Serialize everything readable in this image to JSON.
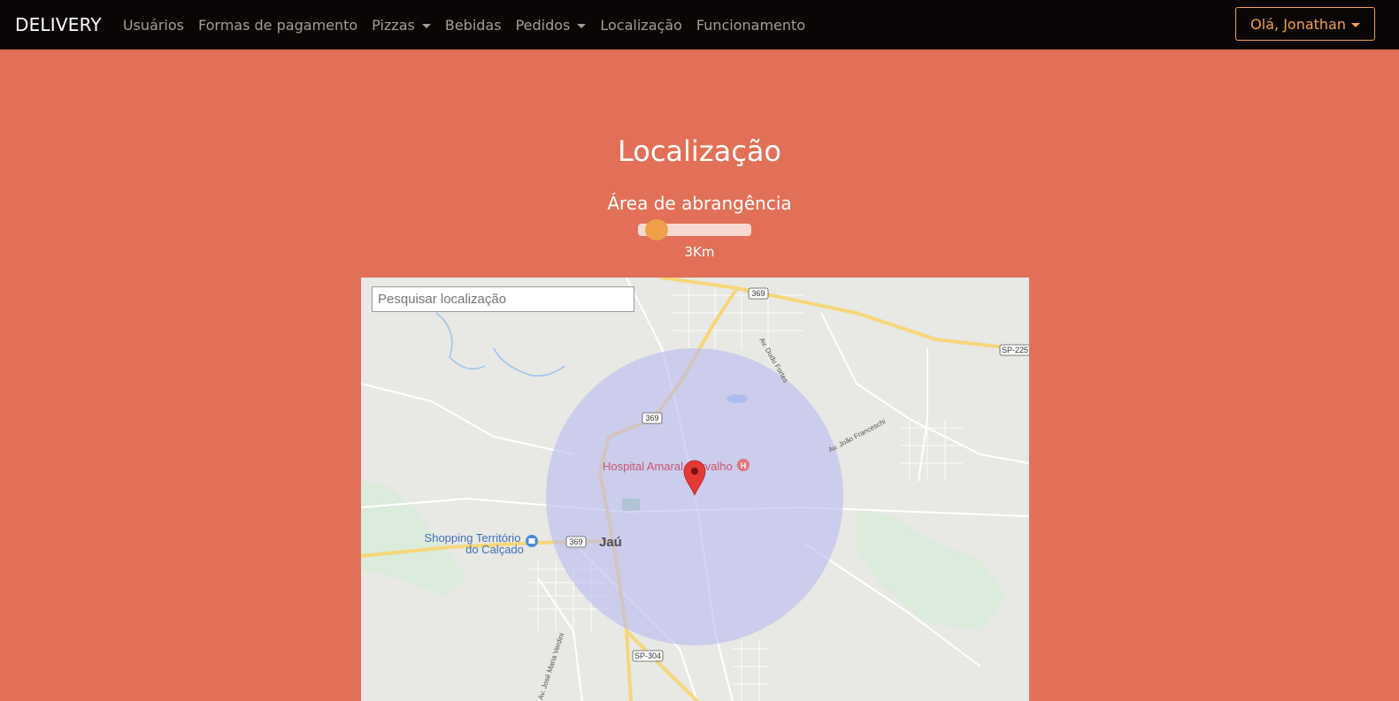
{
  "navbar": {
    "brand": "DELIVERY",
    "items": [
      {
        "label": "Usuários",
        "dropdown": false
      },
      {
        "label": "Formas de pagamento",
        "dropdown": false
      },
      {
        "label": "Pizzas",
        "dropdown": true
      },
      {
        "label": "Bebidas",
        "dropdown": false
      },
      {
        "label": "Pedidos",
        "dropdown": true
      },
      {
        "label": "Localização",
        "dropdown": false
      },
      {
        "label": "Funcionamento",
        "dropdown": false
      }
    ],
    "user_label": "Olá, Jonathan"
  },
  "page": {
    "title": "Localização",
    "subtitle": "Área de abrangência",
    "range_value": "3Km"
  },
  "map": {
    "search_placeholder": "Pesquisar localização",
    "labels": {
      "hospital": "Hospital Amaral Carvalho",
      "shopping_line1": "Shopping Território",
      "shopping_line2": "do Calçado",
      "city": "Jaú",
      "road_369_a": "369",
      "road_369_b": "369",
      "road_369_c": "369",
      "road_sp225": "SP-225",
      "road_sp304": "SP-304",
      "street_dudu": "Av. Dudu Fortes",
      "street_joao": "Av. João Franceschi",
      "street_jose": "Av. José Maria Verdini"
    }
  },
  "colors": {
    "background": "#e27058",
    "navbar": "#0a0605",
    "accent": "#f0a04b",
    "coverage_circle": "#b9b9f2",
    "marker": "#e53935"
  }
}
